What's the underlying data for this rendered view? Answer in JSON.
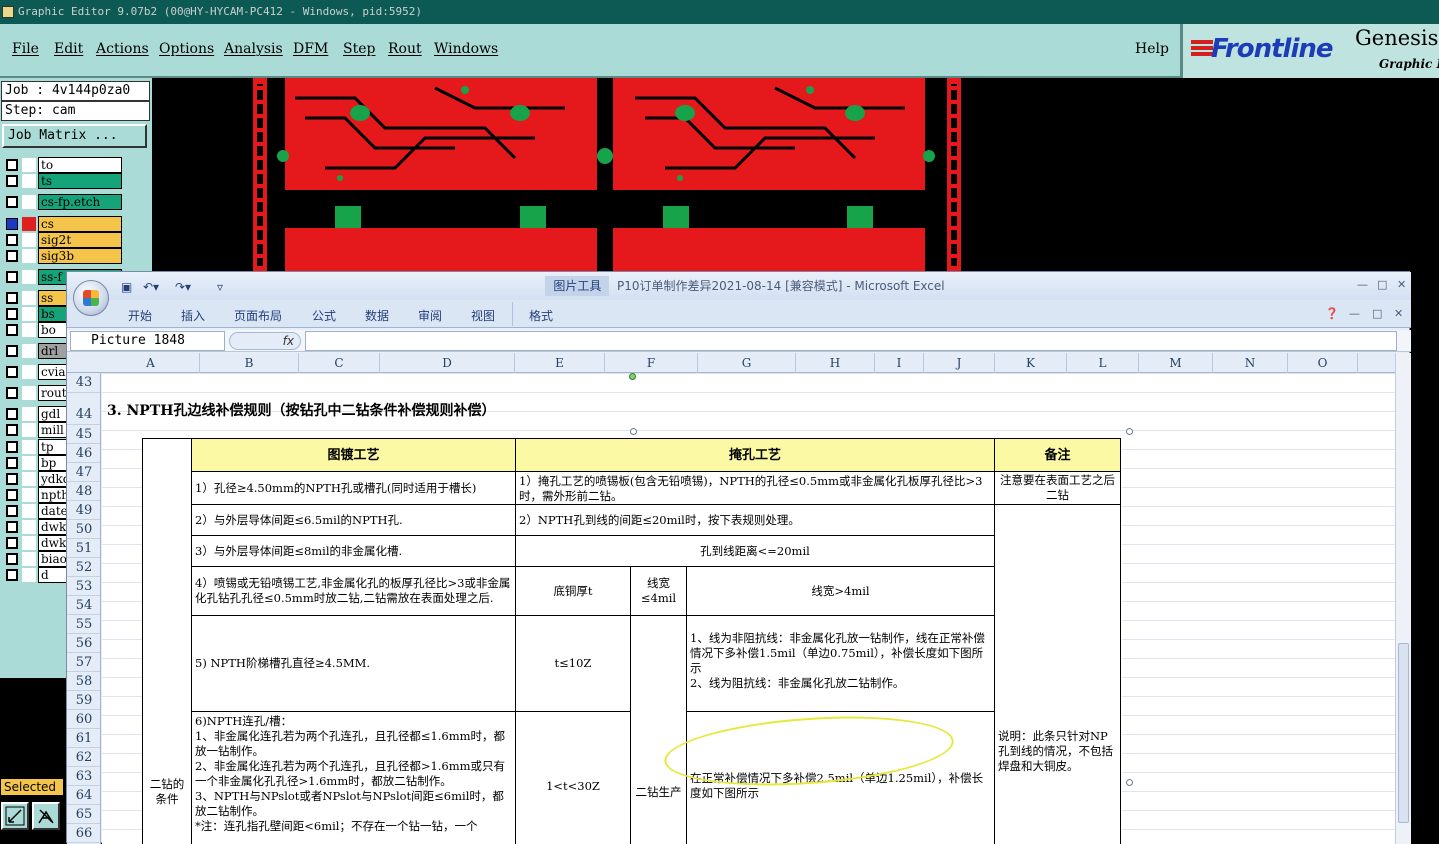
{
  "app": {
    "title": "Graphic Editor 9.07b2 (00@HY-HYCAM-PC412 - Windows, pid:5952)",
    "menu": [
      "File",
      "Edit",
      "Actions",
      "Options",
      "Analysis",
      "DFM",
      "Step",
      "Rout",
      "Windows"
    ],
    "help": "Help",
    "logo_brand": "Frontline",
    "logo_product": "Genesis",
    "logo_sub": "Graphic Editor"
  },
  "panel": {
    "job_label": "Job : 4v144p0za0",
    "step_label": "Step: cam",
    "job_matrix_button": "Job Matrix ...",
    "selected_label": "Selected",
    "layers": [
      {
        "name": "to",
        "color": "w"
      },
      {
        "name": "ts",
        "color": "t"
      },
      {
        "name": "cs-fp.etch",
        "color": "t"
      },
      {
        "name": "cs",
        "color": "y"
      },
      {
        "name": "sig2t",
        "color": "y"
      },
      {
        "name": "sig3b",
        "color": "y"
      },
      {
        "name": "ss-f",
        "color": "t"
      },
      {
        "name": "ss",
        "color": "y"
      },
      {
        "name": "bs",
        "color": "t"
      },
      {
        "name": "bo",
        "color": "w"
      },
      {
        "name": "drl",
        "color": "gy"
      },
      {
        "name": "cvia",
        "color": "w"
      },
      {
        "name": "rout",
        "color": "w"
      },
      {
        "name": "gdl",
        "color": "w"
      },
      {
        "name": "mill",
        "color": "w"
      },
      {
        "name": "tp",
        "color": "w"
      },
      {
        "name": "bp",
        "color": "w"
      },
      {
        "name": "ydkd",
        "color": "w"
      },
      {
        "name": "npth",
        "color": "w"
      },
      {
        "name": "date",
        "color": "w"
      },
      {
        "name": "dwk",
        "color": "w"
      },
      {
        "name": "dwkb",
        "color": "w"
      },
      {
        "name": "biao",
        "color": "w"
      },
      {
        "name": "d",
        "color": "w"
      }
    ]
  },
  "excel": {
    "context_tab": "图片工具",
    "title": "P10订单制作差异2021-08-14  [兼容模式] - Microsoft Excel",
    "tabs": [
      "开始",
      "插入",
      "页面布局",
      "公式",
      "数据",
      "审阅",
      "视图",
      "格式"
    ],
    "name_box": "Picture 1848",
    "fx": "fx",
    "columns": [
      "A",
      "B",
      "C",
      "D",
      "E",
      "F",
      "G",
      "H",
      "I",
      "J",
      "K",
      "L",
      "M",
      "N",
      "O"
    ],
    "rows": [
      "43",
      "44",
      "45",
      "46",
      "47",
      "48",
      "49",
      "50",
      "51",
      "52",
      "53",
      "54",
      "55",
      "56",
      "57",
      "58",
      "59",
      "60",
      "61",
      "62",
      "63",
      "64",
      "65",
      "66"
    ],
    "section_title": "3. NPTH孔边线补偿规则（按钻孔中二钻条件补偿规则补偿）"
  },
  "table": {
    "h_plating": "图镀工艺",
    "h_tenting": "掩孔工艺",
    "h_note": "备注",
    "side_label": "二钻的条件",
    "r1_left": "1）孔径≥4.50mm的NPTH孔或槽孔(同时适用于槽长)",
    "r1_mid": "1）掩孔工艺的喷锡板(包含无铅喷锡)，NPTH的孔径≤0.5mm或非金属化孔板厚孔径比>3时，需外形前二钻。",
    "r1_note": "注意要在表面工艺之后二钻",
    "r2_left": "2）与外层导体间距≤6.5mil的NPTH孔.",
    "r2_mid": "2）NPTH孔到线的间距≤20mil时，按下表规则处理。",
    "r3_left": "3）与外层导体间距≤8mil的非金属化槽.",
    "r3_mid": "孔到线距离<=20mil",
    "r4_left": "4）喷锡或无铅喷锡工艺,非金属化孔的板厚孔径比>3或非金属化孔钻孔孔径≤0.5mm时放二钻,二钻需放在表面处理之后.",
    "r4_c1": "底铜厚t",
    "r4_c2": "线宽≤4mil",
    "r4_c3": "线宽>4mil",
    "r5_left": "5) NPTH阶梯槽孔直径≥4.5MM.",
    "r5_c1": "t≤10Z",
    "r5_c3": "1、线为非阻抗线：非金属化孔放一钻制作，线在正常补偿情况下多补偿1.5mil（单边0.75mil），补偿长度如下图所示\n2、线为阻抗线：非金属化孔放二钻制作。",
    "r6_left": "6)NPTH连孔/槽：\n1、非金属化连孔若为两个孔连孔，且孔径都≤1.6mm时，都放一钻制作。\n2、非金属化连孔若为两个孔连孔，且孔径都>1.6mm或只有一个非金属化孔孔径>1.6mm时，都放二钻制作。\n3、NPTH与NPslot或者NPslot与NPslot间距≤6mil时，都放二钻制作。\n*注：连孔指孔壁间距<6mil；不存在一个钻一钻，一个",
    "r6_c1": "1<t<30Z",
    "r6_c2": "二钻生产",
    "r6_c3": "在正常补偿情况下多补偿2.5mil（单边1.25mil），补偿长度如下图所示",
    "note_lower": "说明：此条只针对NP孔到线的情况，不包括焊盘和大铜皮。"
  }
}
